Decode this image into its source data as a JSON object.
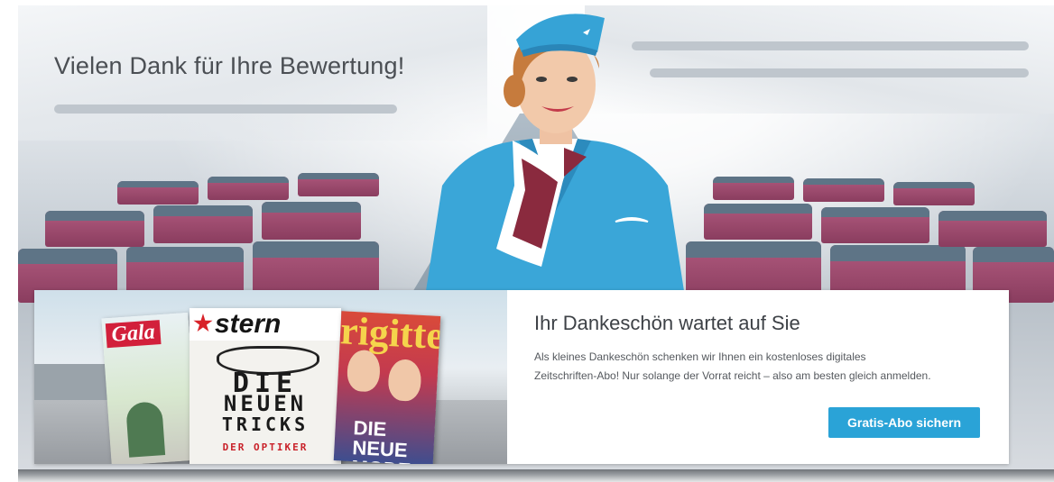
{
  "hero": {
    "headline": "Vielen Dank für Ihre Bewertung!"
  },
  "promo": {
    "title": "Ihr Dankeschön wartet auf Sie",
    "body": "Als kleines Dankeschön schenken wir Ihnen ein kostenloses digitales Zeitschriften-Abo! Nur solange der Vorrat reicht – also am besten gleich anmelden.",
    "cta_label": "Gratis-Abo sichern",
    "magazines": {
      "gala": "Gala",
      "stern": "stern",
      "stern_headline": [
        "DIE",
        "NEUEN",
        "TRICKS",
        "DER OPTIKER"
      ],
      "brigitte": "rigitte",
      "brigitte_headline": [
        "DIE",
        "NEUE",
        "MODE"
      ]
    }
  },
  "colors": {
    "cta": "#2aa3d7",
    "seat": "#a04f72",
    "uniform": "#3aa6d8"
  }
}
